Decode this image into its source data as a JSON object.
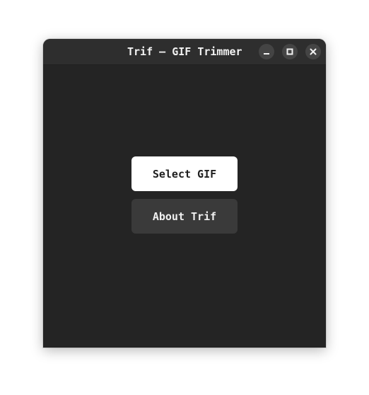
{
  "window": {
    "title": "Trif – GIF Trimmer",
    "controls": {
      "minimize_icon": "minimize-icon",
      "maximize_icon": "maximize-icon",
      "close_icon": "close-icon"
    }
  },
  "main": {
    "select_gif_label": "Select GIF",
    "about_label": "About Trif"
  },
  "colors": {
    "window_bg": "#242424",
    "titlebar_bg": "#2e2e2e",
    "primary_button_bg": "#ffffff",
    "secondary_button_bg": "#3a3a3a",
    "control_button_bg": "#444444"
  }
}
